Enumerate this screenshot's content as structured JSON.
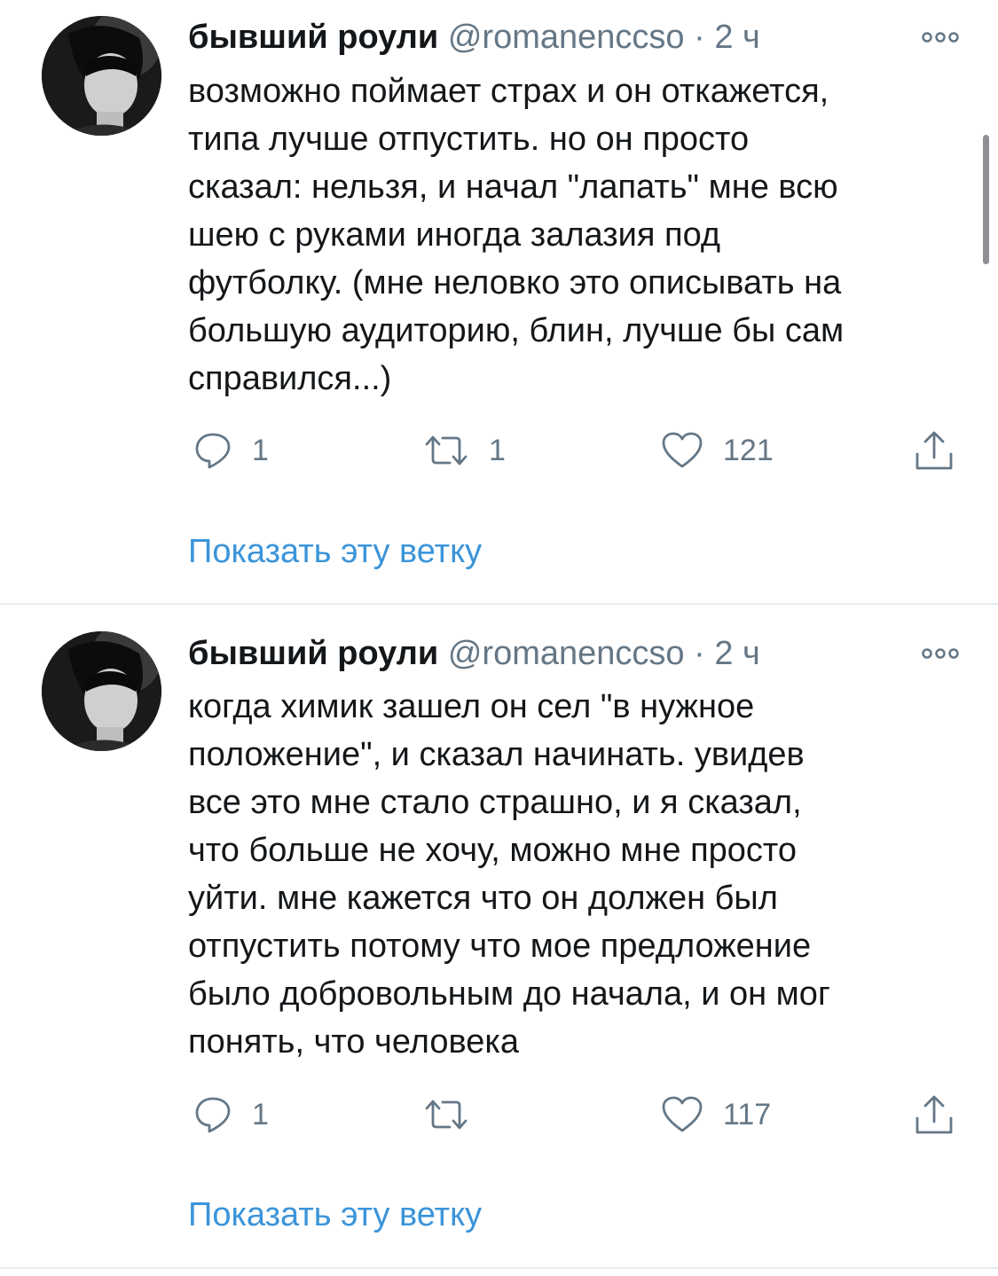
{
  "tweets": [
    {
      "name": "бывший роули",
      "handle": "@romanenccso",
      "dot": "·",
      "time": "2 ч",
      "text_lines": [
        "возможно поймает страх и он откажется,",
        "типа лучше отпустить. но он просто",
        "сказал: нельзя, и начал \"лапать\" мне всю",
        "шею с руками иногда залазия под",
        "футболку. (мне неловко это описывать на",
        "большую аудиторию, блин, лучше бы сам",
        "справился...)"
      ],
      "replies": "1",
      "retweets": "1",
      "likes": "121",
      "show_thread": "Показать эту ветку"
    },
    {
      "name": "бывший роули",
      "handle": "@romanenccso",
      "dot": "·",
      "time": "2 ч",
      "text_lines": [
        "когда химик зашел он сел \"в нужное",
        "положение\", и сказал начинать. увидев",
        "все это мне стало страшно, и я сказал,",
        "что больше не хочу, можно мне просто",
        "уйти. мне кажется что он должен был",
        "отпустить потому что мое предложение",
        "было добровольным до начала, и он мог",
        "понять, что человека"
      ],
      "replies": "1",
      "retweets": "",
      "likes": "117",
      "show_thread": "Показать эту ветку"
    }
  ],
  "icons": {
    "reply": "reply-icon",
    "retweet": "retweet-icon",
    "like": "heart-icon",
    "share": "share-icon",
    "more": "more-icon"
  },
  "colors": {
    "text": "#14171a",
    "secondary": "#657786",
    "link": "#3b94d9",
    "divider": "#e6ecf0"
  }
}
